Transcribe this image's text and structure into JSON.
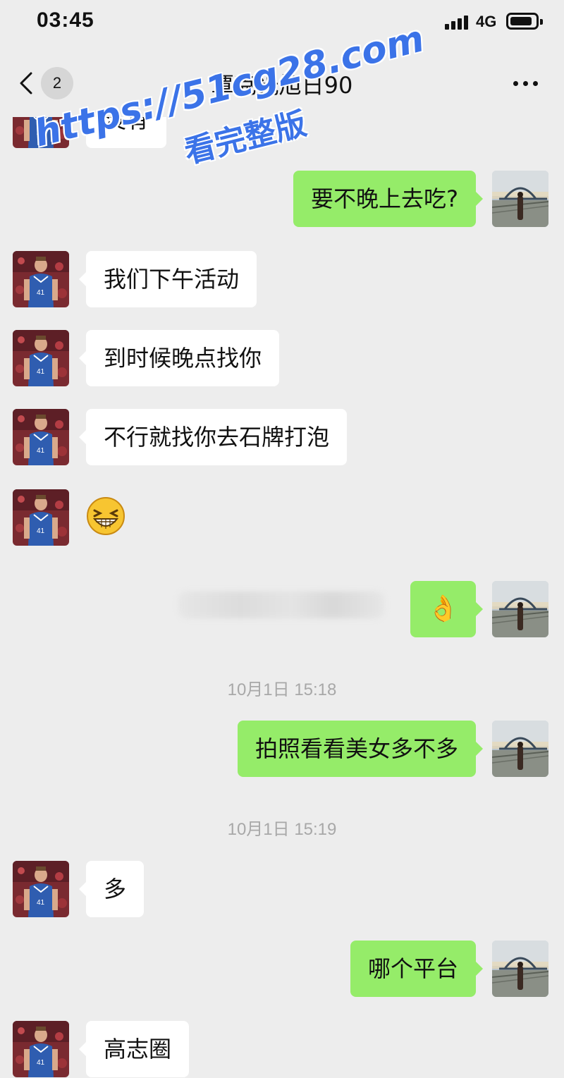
{
  "status_bar": {
    "time": "03:45",
    "network": "4G"
  },
  "nav": {
    "unread_count": "2",
    "title": "覃克光旭日90"
  },
  "messages": [
    {
      "side": "in",
      "text": "没有"
    },
    {
      "side": "out",
      "text": "要不晚上去吃?"
    },
    {
      "side": "in",
      "text": "我们下午活动"
    },
    {
      "side": "in",
      "text": "到时候晚点找你"
    },
    {
      "side": "in",
      "text": "不行就找你去石牌打泡"
    },
    {
      "side": "in",
      "type": "emoji",
      "emoji": "grinning-squint-face"
    },
    {
      "side": "out",
      "text": "👌"
    },
    {
      "type": "time",
      "text": "10月1日 15:18"
    },
    {
      "side": "out",
      "text": "拍照看看美女多不多"
    },
    {
      "type": "time",
      "text": "10月1日 15:19"
    },
    {
      "side": "in",
      "text": "多"
    },
    {
      "side": "out",
      "text": "哪个平台"
    },
    {
      "side": "in",
      "text": "高志圈"
    }
  ],
  "watermark": {
    "url": "https://51cg28.com",
    "subtitle": "看完整版"
  },
  "colors": {
    "incoming_bubble": "#ffffff",
    "outgoing_bubble": "#95ec69",
    "background": "#ededed",
    "watermark": "#3b73e8"
  }
}
